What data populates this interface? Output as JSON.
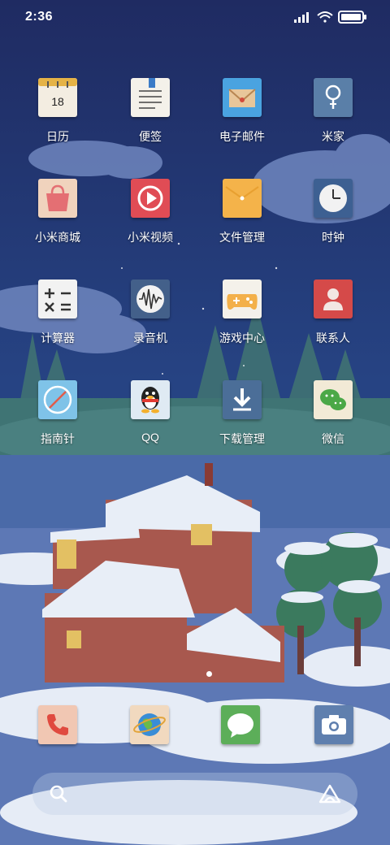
{
  "status_bar": {
    "time": "2:36"
  },
  "apps": [
    {
      "label": "日历",
      "icon": "calendar-icon",
      "badge_text": "18"
    },
    {
      "label": "便签",
      "icon": "notes-icon"
    },
    {
      "label": "电子邮件",
      "icon": "email-icon"
    },
    {
      "label": "米家",
      "icon": "mijia-icon"
    },
    {
      "label": "小米商城",
      "icon": "mall-bag-icon"
    },
    {
      "label": "小米视频",
      "icon": "video-play-icon"
    },
    {
      "label": "文件管理",
      "icon": "folder-icon"
    },
    {
      "label": "时钟",
      "icon": "clock-icon"
    },
    {
      "label": "计算器",
      "icon": "calculator-icon"
    },
    {
      "label": "录音机",
      "icon": "recorder-icon"
    },
    {
      "label": "游戏中心",
      "icon": "gamepad-icon"
    },
    {
      "label": "联系人",
      "icon": "contacts-icon"
    },
    {
      "label": "指南针",
      "icon": "compass-icon"
    },
    {
      "label": "QQ",
      "icon": "qq-penguin-icon"
    },
    {
      "label": "下载管理",
      "icon": "download-icon"
    },
    {
      "label": "微信",
      "icon": "wechat-icon"
    }
  ],
  "dock": [
    {
      "icon": "phone-icon"
    },
    {
      "icon": "browser-globe-icon"
    },
    {
      "icon": "messages-icon"
    },
    {
      "icon": "camera-icon"
    }
  ],
  "search_bar": {
    "icon": "search-icon",
    "right_icon": "assistant-icon"
  },
  "colors": {
    "sky_top": "#1f2d63",
    "sky_bottom": "#2d4a86",
    "snow": "#e9eef7",
    "text": "#ffffff"
  }
}
